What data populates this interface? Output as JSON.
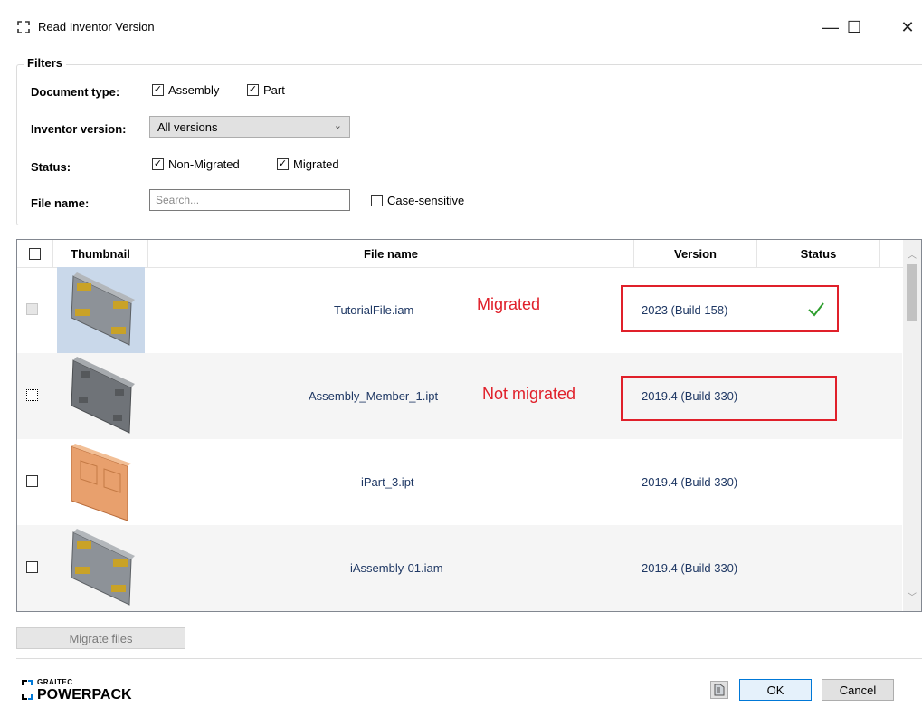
{
  "window": {
    "title": "Read Inventor Version",
    "minimize_glyph": "—",
    "maximize_glyph": "☐",
    "close_glyph": "✕"
  },
  "filters": {
    "group_title": "Filters",
    "document_type_label": "Document type:",
    "assembly_label": "Assembly",
    "assembly_checked": true,
    "part_label": "Part",
    "part_checked": true,
    "inventor_version_label": "Inventor version:",
    "inventor_version_value": "All versions",
    "status_label": "Status:",
    "non_migrated_label": "Non-Migrated",
    "non_migrated_checked": true,
    "migrated_label": "Migrated",
    "migrated_checked": true,
    "file_name_label": "File name:",
    "search_placeholder": "Search...",
    "case_sensitive_label": "Case-sensitive",
    "case_sensitive_checked": false
  },
  "grid": {
    "columns": [
      "Thumbnail",
      "File name",
      "Version",
      "Status"
    ],
    "rows": [
      {
        "file_name": "TutorialFile.iam",
        "version": "2023 (Build 158)",
        "status": "check",
        "thumbnail": "assembly-gray",
        "checkbox": "disabled"
      },
      {
        "file_name": "Assembly_Member_1.ipt",
        "version": "2019.4 (Build 330)",
        "status": "",
        "thumbnail": "part-gray",
        "checkbox": "focused"
      },
      {
        "file_name": "iPart_3.ipt",
        "version": "2019.4 (Build 330)",
        "status": "",
        "thumbnail": "part-orange",
        "checkbox": "unchecked"
      },
      {
        "file_name": "iAssembly-01.iam",
        "version": "2019.4 (Build 330)",
        "status": "",
        "thumbnail": "assembly-gray",
        "checkbox": "unchecked"
      }
    ]
  },
  "annotations": {
    "migrated": "Migrated",
    "not_migrated": "Not migrated",
    "color": "#e0202a"
  },
  "footer": {
    "migrate_button": "Migrate files",
    "brand_small": "GRAITEC",
    "brand_large": "POWERPACK",
    "ok_button": "OK",
    "cancel_button": "Cancel"
  },
  "colors": {
    "accent": "#0078d7",
    "value_text": "#1f3864",
    "check": "#2e9e2e"
  }
}
